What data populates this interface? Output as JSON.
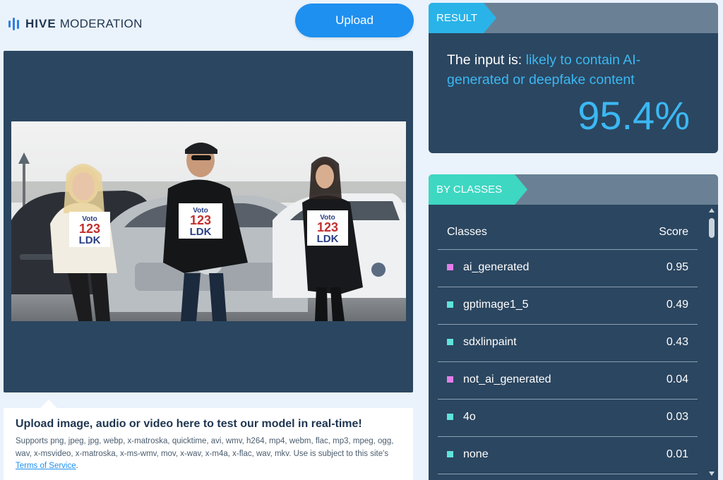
{
  "brand": {
    "name_bold": "HIVE",
    "name_light": "MODERATION"
  },
  "header": {
    "upload_label": "Upload"
  },
  "preview": {
    "image_alt": "Three people holding Voto 123 LDK signs in front of cars",
    "sign_lines": [
      "Voto",
      "123",
      "LDK"
    ]
  },
  "info": {
    "title": "Upload image, audio or video here to test our model in real-time!",
    "description": "Supports png, jpeg, jpg, webp, x-matroska, quicktime, avi, wmv, h264, mp4, webm, flac, mp3, mpeg, ogg, wav, x-msvideo, x-matroska, x-ms-wmv, mov, x-wav, x-m4a, x-flac, wav, mkv. Use is subject to this site's",
    "tos_link": "Terms of Service",
    "tos_suffix": "."
  },
  "result": {
    "tag": "RESULT",
    "prefix": "The input is: ",
    "verdict": "likely to contain AI-generated or deepfake content",
    "score": "95.4%"
  },
  "classes": {
    "tag": "BY CLASSES",
    "col_class": "Classes",
    "col_score": "Score",
    "rows": [
      {
        "name": "ai_generated",
        "score": "0.95",
        "color": "#e27ee8"
      },
      {
        "name": "gptimage1_5",
        "score": "0.49",
        "color": "#5fe3dc"
      },
      {
        "name": "sdxlinpaint",
        "score": "0.43",
        "color": "#5fe3dc"
      },
      {
        "name": "not_ai_generated",
        "score": "0.04",
        "color": "#e27ee8"
      },
      {
        "name": "4o",
        "score": "0.03",
        "color": "#5fe3dc"
      },
      {
        "name": "none",
        "score": "0.01",
        "color": "#5fe3dc"
      }
    ]
  },
  "colors": {
    "accent_blue": "#1e90f0",
    "result_tag": "#29b3e8",
    "classes_tag": "#3ed7c2",
    "panel_bg": "#2b4660",
    "verdict_text": "#3bb8f3"
  }
}
